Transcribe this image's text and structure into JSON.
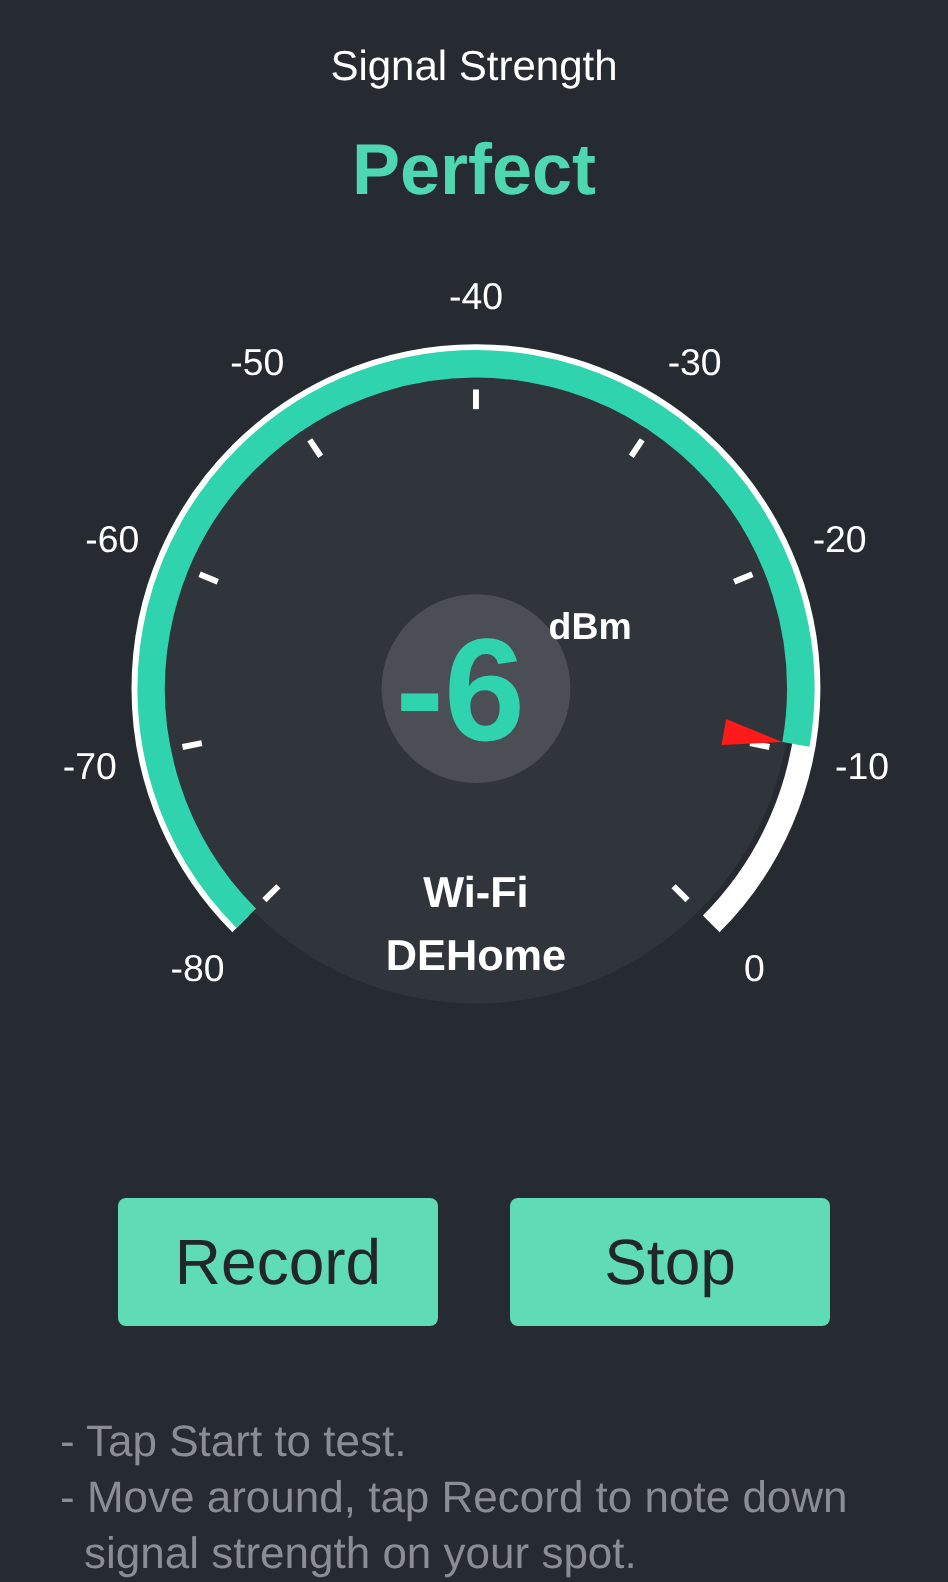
{
  "title": "Signal Strength",
  "status": "Perfect",
  "gauge": {
    "ticks": [
      "-80",
      "-70",
      "-60",
      "-50",
      "-40",
      "-30",
      "-20",
      "-10",
      "0"
    ],
    "value": "-6",
    "unit": "dBm",
    "network_type": "Wi-Fi",
    "network_name": "DEHome"
  },
  "buttons": [
    "Record",
    "Stop"
  ],
  "tips": [
    "- Tap Start to test.",
    "- Move around, tap Record to note down signal strength on your spot."
  ]
}
